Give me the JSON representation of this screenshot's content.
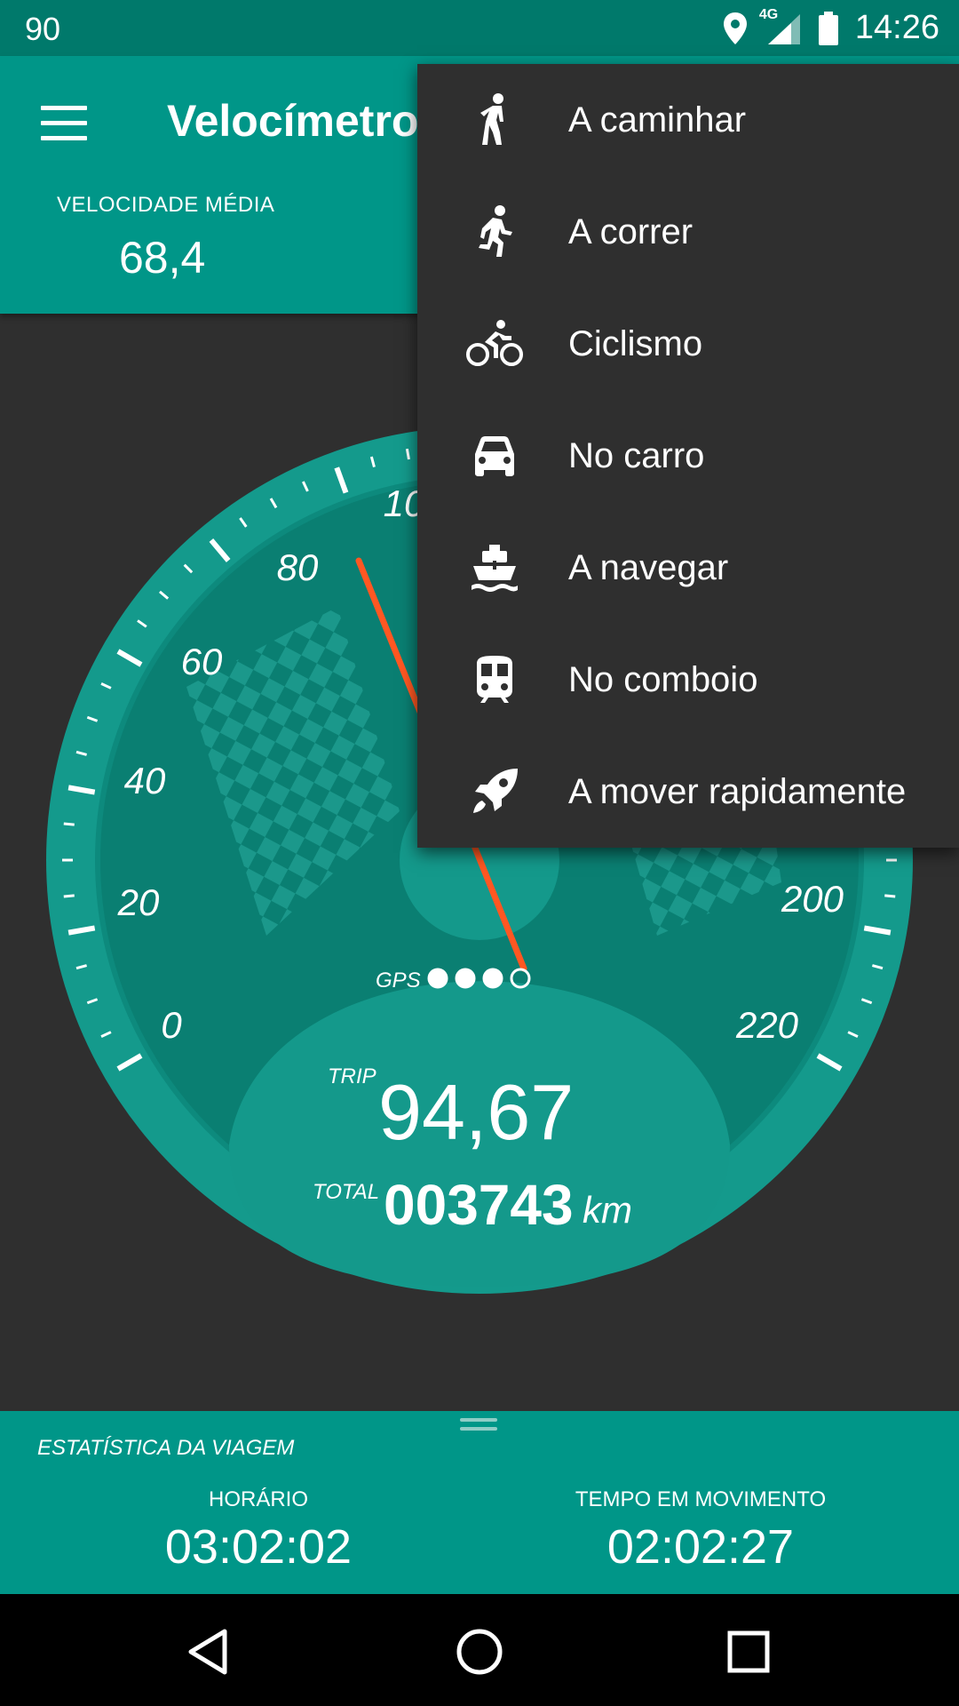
{
  "status": {
    "left_text": "90",
    "network": "4G",
    "time": "14:26"
  },
  "app": {
    "title": "Velocímetro"
  },
  "stats": {
    "avg_label": "VELOCIDADE MÉDIA",
    "avg_value": "68,4"
  },
  "gauge": {
    "labels": [
      "0",
      "20",
      "40",
      "60",
      "80",
      "10",
      "200",
      "220"
    ],
    "gps_label": "GPS",
    "gps_signal": 3,
    "gps_max": 4,
    "trip_label": "TRIP",
    "trip_value": "94,67",
    "total_label": "TOTAL",
    "total_value": "003743",
    "unit": "km"
  },
  "menu": {
    "items": [
      {
        "label": "A caminhar",
        "icon": "walk-icon"
      },
      {
        "label": "A correr",
        "icon": "run-icon"
      },
      {
        "label": "Ciclismo",
        "icon": "bike-icon"
      },
      {
        "label": "No carro",
        "icon": "car-icon"
      },
      {
        "label": "A navegar",
        "icon": "boat-icon"
      },
      {
        "label": "No comboio",
        "icon": "train-icon"
      },
      {
        "label": "A mover rapidamente",
        "icon": "rocket-icon"
      }
    ]
  },
  "trip_stats": {
    "title": "ESTATÍSTICA DA VIAGEM",
    "clock_label": "HORÁRIO",
    "clock_value": "03:02:02",
    "moving_label": "TEMPO EM MOVIMENTO",
    "moving_value": "02:02:27"
  },
  "colors": {
    "primary": "#009688",
    "primary_dark": "#00796b",
    "needle": "#ff5722",
    "menu_bg": "#2f2f2f"
  }
}
